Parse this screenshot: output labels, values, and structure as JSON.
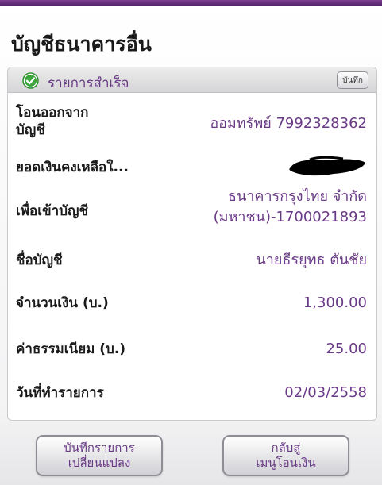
{
  "page": {
    "title": "บัญชีธนาคารอื่น"
  },
  "status": {
    "text": "รายการสำเร็จ",
    "save_label": "บันทึก"
  },
  "fields": {
    "from_label_1": "โอนออกจาก",
    "from_label_2": "บัญชี",
    "from_value": "ออมทรัพย์ 7992328362",
    "balance_label": "ยอดเงินคงเหลือใ...",
    "to_label": "เพื่อเข้าบัญชี",
    "to_value_1": "ธนาคารกรุงไทย จำกัด",
    "to_value_2": "(มหาชน)-1700021893",
    "name_label": "ชื่อบัญชี",
    "name_value": "นายธีรยุทธ ตันชัย",
    "amount_label": "จำนวนเงิน (บ.)",
    "amount_value": "1,300.00",
    "fee_label": "ค่าธรรมเนียม (บ.)",
    "fee_value": "25.00",
    "date_label": "วันที่ทำรายการ",
    "date_value": "02/03/2558"
  },
  "buttons": {
    "save_change_line1": "บันทึกรายการ",
    "save_change_line2": "เปลี่ยนแปลง",
    "back_line1": "กลับสู่",
    "back_line2": "เมนูโอนเงิน"
  },
  "colors": {
    "accent": "#6a3a86",
    "success": "#3aa53a",
    "bar": "#5a2a72"
  },
  "icons": {
    "status": "check-circle-icon"
  }
}
